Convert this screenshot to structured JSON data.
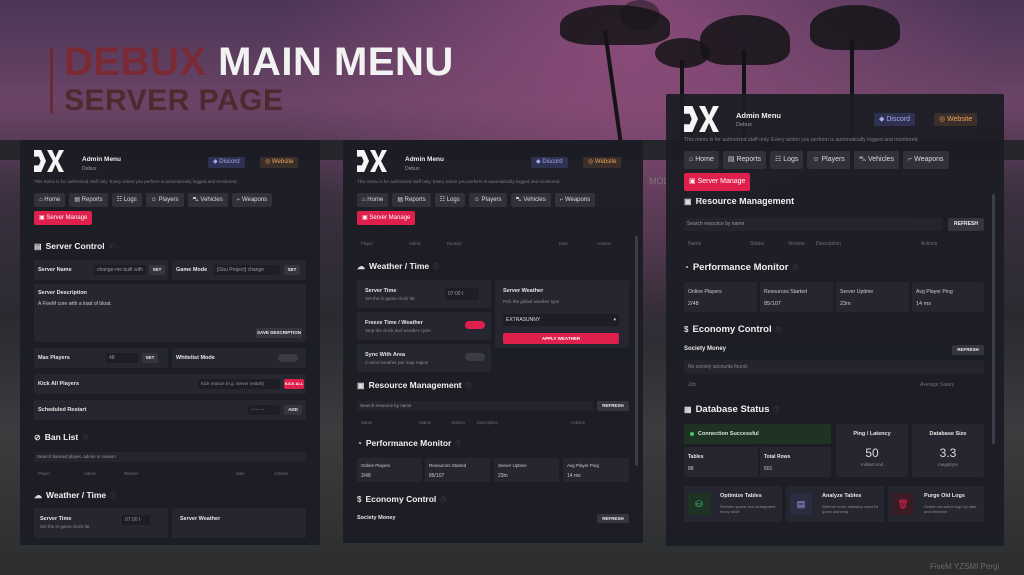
{
  "title": {
    "main_red": "DEBUX",
    "main_white": "MAIN MENU",
    "sub": "SERVER PAGE"
  },
  "header": {
    "app": "Admin Menu",
    "brand": "Debux",
    "discord": "Discord",
    "website": "Website",
    "notice": "This menu is for authorized staff only. Every action you perform is automatically logged and monitored."
  },
  "nav": [
    "Home",
    "Reports",
    "Logs",
    "Players",
    "Vehicles",
    "Weapons",
    "Server Manage"
  ],
  "icons": {
    "home": "house-icon",
    "reports": "clipboard-icon",
    "logs": "list-icon",
    "players": "users-icon",
    "vehicles": "car-icon",
    "weapons": "gun-icon",
    "server": "server-icon"
  },
  "colors": {
    "accent": "#e0204c",
    "discord": "#a5a8f0",
    "website": "#f0a45a",
    "success": "#3ec46d"
  },
  "server_control": {
    "title": "Server Control",
    "server_name_label": "Server Name",
    "server_name_value": "change-me built with",
    "set": "SET",
    "game_mode_label": "Game Mode",
    "game_mode_value": "[Gbu Project] change",
    "desc_label": "Server Description",
    "desc_value": "A FiveM core with a load of bloat.",
    "save_desc": "SAVE DESCRIPTION",
    "max_players_label": "Max Players",
    "max_players_value": "48",
    "whitelist_label": "Whitelist Mode",
    "kick_all_label": "Kick All Players",
    "kick_placeholder": "Kick reason (e.g. server restart)",
    "kick_all_btn": "KICK ALL",
    "restart_label": "Scheduled Restart",
    "restart_value": "--:-- --",
    "add": "ADD"
  },
  "ban_list": {
    "title": "Ban List",
    "search": "Search banned player, admin or reason",
    "cols": [
      "Player",
      "Admin",
      "Reason",
      "Date",
      "Actions"
    ]
  },
  "weather": {
    "title": "Weather / Time",
    "server_time_label": "Server Time",
    "server_time_sub": "Set the in-game clock fat",
    "server_time_value": "07:00 I",
    "server_weather_label": "Server Weather",
    "server_weather_sub": "Pick the global weather type",
    "weather_value": "EXTRASUNNY",
    "apply": "APPLY WEATHER",
    "freeze_label": "Freeze Time / Weather",
    "freeze_sub": "Stop the clock and weather cycle",
    "sync_label": "Sync With Area",
    "sync_sub": "Control weather per map region"
  },
  "resources": {
    "title": "Resource Management",
    "search": "Search resource by name",
    "refresh": "REFRESH",
    "cols": [
      "Name",
      "Status",
      "Version",
      "Description",
      "Actions"
    ]
  },
  "performance": {
    "title": "Performance Monitor",
    "stats": [
      {
        "label": "Online Players",
        "value": "2/48"
      },
      {
        "label": "Resources Started",
        "value": "85/107"
      },
      {
        "label": "Server Uptime",
        "value": "23m"
      },
      {
        "label": "Avg Player Ping",
        "value": "14 ms"
      }
    ]
  },
  "economy": {
    "title": "Economy Control",
    "society_label": "Society Money",
    "refresh": "REFRESH",
    "empty": "No society accounts found.",
    "cols": [
      "Job",
      "Average Salary"
    ]
  },
  "database": {
    "title": "Database Status",
    "connection": "Connection Successful",
    "ping_label": "Ping / Latency",
    "ping_value": "50",
    "ping_unit": "millisecond",
    "size_label": "Database Size",
    "size_value": "3.3",
    "size_unit": "megabyte",
    "tables_label": "Tables",
    "tables_value": "88",
    "rows_label": "Total Rows",
    "rows_value": "501",
    "actions": [
      {
        "title": "Optimize Tables",
        "desc": "Reclaim space and defragment every table"
      },
      {
        "title": "Analyze Tables",
        "desc": "Refresh index statistics used for query planning"
      },
      {
        "title": "Purge Old Logs",
        "desc": "Delete old action logs by date and retention"
      }
    ]
  },
  "bg_text": {
    "mod": "MOD",
    "footer": "FiveM YZSMI Pergi"
  }
}
